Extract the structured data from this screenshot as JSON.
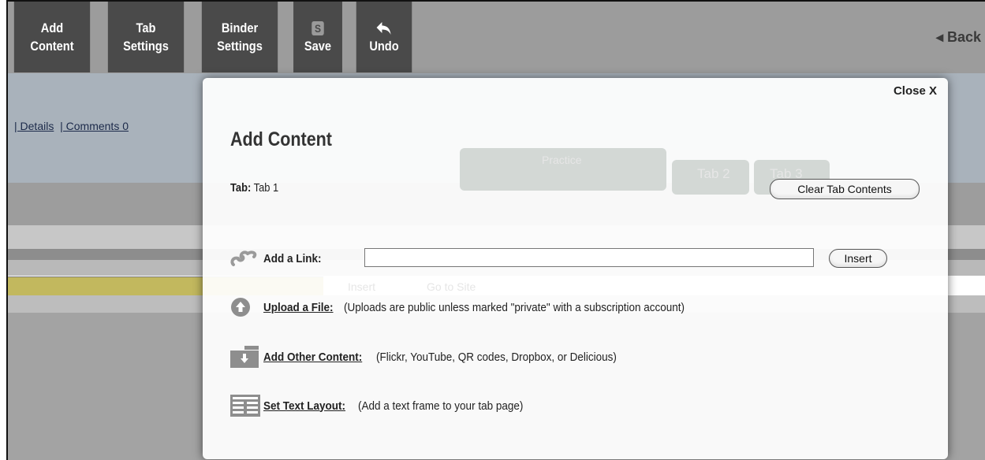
{
  "toolbar": {
    "buttons": [
      {
        "label_line1": "Add",
        "label_line2": "Content",
        "icon": ""
      },
      {
        "label_line1": "Tab",
        "label_line2": "Settings",
        "icon": ""
      },
      {
        "label_line1": "Binder",
        "label_line2": "Settings",
        "icon": ""
      },
      {
        "label_line1": "Save",
        "icon": "save-icon",
        "icon_glyph": "S"
      },
      {
        "label_line1": "Undo",
        "icon": "undo-icon"
      }
    ],
    "back_label": "◂ Back"
  },
  "background": {
    "links": [
      "| Details",
      "| Comments 0"
    ],
    "practice_label": "Practice",
    "tab2_label": "Tab 2",
    "tab3_label": "Tab 3",
    "insert_label": "Insert",
    "goto_label": "Go to Site"
  },
  "modal": {
    "close_label": "Close X",
    "title": "Add Content",
    "tab_prefix": "Tab:",
    "tab_value": "Tab 1",
    "clear_button": "Clear Tab Contents",
    "add_link": {
      "label": "Add a Link:",
      "value": "",
      "insert_button": "Insert"
    },
    "upload": {
      "label": "Upload a File:",
      "desc": "(Uploads are public unless marked \"private\" with a subscription account)"
    },
    "other": {
      "label": "Add Other Content:",
      "desc": "(Flickr, YouTube, QR codes, Dropbox, or Delicious)"
    },
    "text_layout": {
      "label": "Set Text Layout:",
      "desc": "(Add a text frame to your tab page)"
    }
  },
  "colors": {
    "toolbar_button": "#4a4a4a",
    "blue_band": "#a9b2bb",
    "yellow_bar": "#c2b85e"
  }
}
